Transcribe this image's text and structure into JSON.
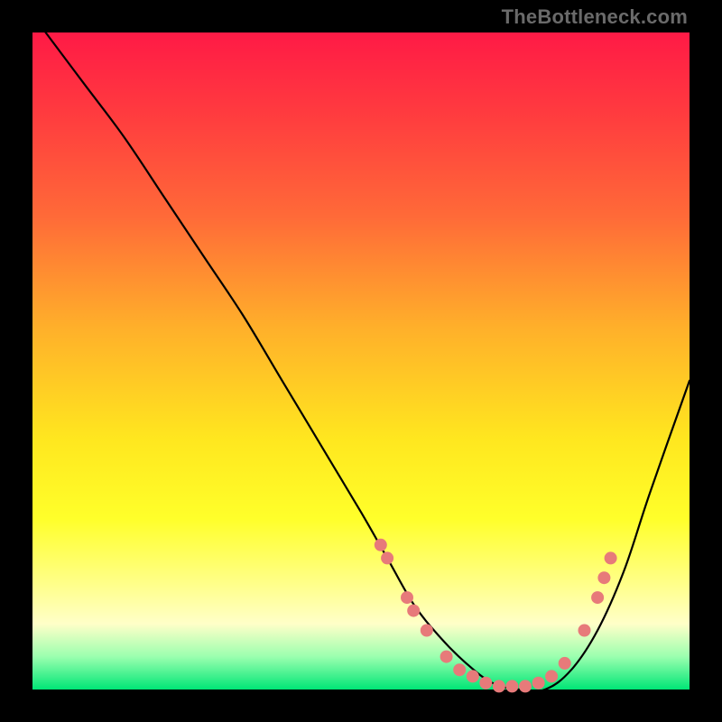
{
  "attribution": "TheBottleneck.com",
  "chart_data": {
    "type": "line",
    "title": "",
    "xlabel": "",
    "ylabel": "",
    "xlim": [
      0,
      100
    ],
    "ylim": [
      0,
      100
    ],
    "gradient_stops": [
      {
        "offset": 0,
        "color": "#ff1a46"
      },
      {
        "offset": 12,
        "color": "#ff3a3f"
      },
      {
        "offset": 28,
        "color": "#ff6a38"
      },
      {
        "offset": 45,
        "color": "#ffb02a"
      },
      {
        "offset": 62,
        "color": "#ffe71f"
      },
      {
        "offset": 74,
        "color": "#ffff2a"
      },
      {
        "offset": 84,
        "color": "#ffff8a"
      },
      {
        "offset": 90,
        "color": "#ffffc8"
      },
      {
        "offset": 95,
        "color": "#9bffaf"
      },
      {
        "offset": 100,
        "color": "#00e676"
      }
    ],
    "series": [
      {
        "name": "bottleneck-curve",
        "x": [
          2,
          8,
          14,
          20,
          26,
          32,
          38,
          44,
          50,
          54,
          58,
          62,
          66,
          70,
          74,
          78,
          82,
          86,
          90,
          94,
          100
        ],
        "y": [
          100,
          92,
          84,
          75,
          66,
          57,
          47,
          37,
          27,
          20,
          13,
          8,
          4,
          1,
          0,
          0,
          3,
          9,
          18,
          30,
          47
        ]
      }
    ],
    "markers": [
      {
        "x": 53,
        "y": 22
      },
      {
        "x": 54,
        "y": 20
      },
      {
        "x": 57,
        "y": 14
      },
      {
        "x": 58,
        "y": 12
      },
      {
        "x": 60,
        "y": 9
      },
      {
        "x": 63,
        "y": 5
      },
      {
        "x": 65,
        "y": 3
      },
      {
        "x": 67,
        "y": 2
      },
      {
        "x": 69,
        "y": 1
      },
      {
        "x": 71,
        "y": 0.5
      },
      {
        "x": 73,
        "y": 0.5
      },
      {
        "x": 75,
        "y": 0.5
      },
      {
        "x": 77,
        "y": 1
      },
      {
        "x": 79,
        "y": 2
      },
      {
        "x": 81,
        "y": 4
      },
      {
        "x": 84,
        "y": 9
      },
      {
        "x": 86,
        "y": 14
      },
      {
        "x": 87,
        "y": 17
      },
      {
        "x": 88,
        "y": 20
      }
    ],
    "marker_radius": 7,
    "marker_color": "#e77a7a"
  }
}
